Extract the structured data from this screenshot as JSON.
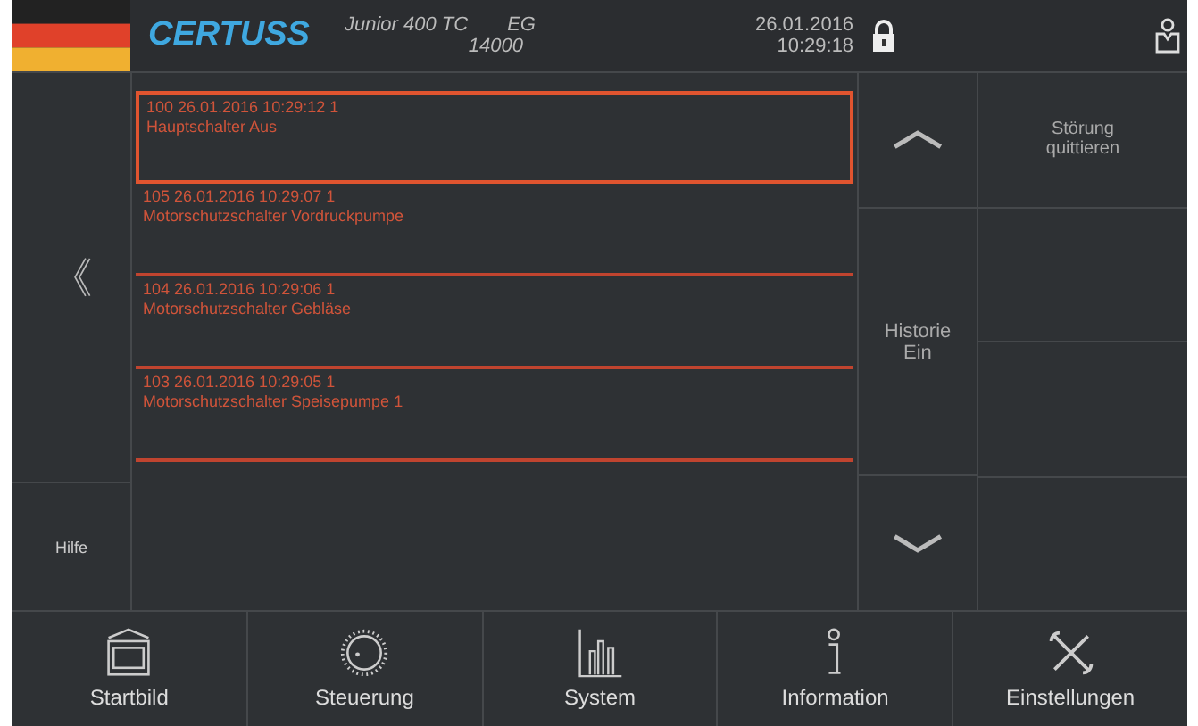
{
  "header": {
    "brand": "CERTUSS",
    "model": "Junior 400 TC",
    "level": "EG",
    "serial": "14000",
    "date": "26.01.2016",
    "time": "10:29:18"
  },
  "side": {
    "back": "《",
    "help": "Hilfe"
  },
  "messages": [
    {
      "head": "100  26.01.2016  10:29:12  1",
      "text": "Hauptschalter Aus",
      "selected": true
    },
    {
      "head": "105  26.01.2016  10:29:07  1",
      "text": "Motorschutzschalter Vordruckpumpe",
      "selected": false
    },
    {
      "head": "104  26.01.2016  10:29:06  1",
      "text": "Motorschutzschalter Gebläse",
      "selected": false
    },
    {
      "head": "103  26.01.2016  10:29:05  1",
      "text": "Motorschutzschalter Speisepumpe 1",
      "selected": false
    }
  ],
  "actions": {
    "history": "Historie\nEin",
    "acknowledge": "Störung\nquittieren"
  },
  "nav": [
    {
      "kind": "home",
      "label": "Startbild"
    },
    {
      "kind": "control",
      "label": "Steuerung"
    },
    {
      "kind": "system",
      "label": "System"
    },
    {
      "kind": "info",
      "label": "Information"
    },
    {
      "kind": "settings",
      "label": "Einstellungen"
    }
  ]
}
